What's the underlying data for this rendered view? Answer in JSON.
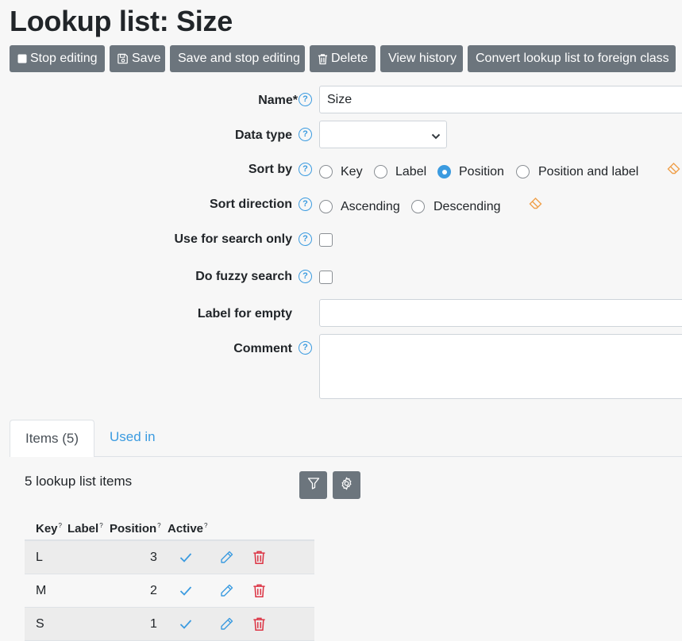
{
  "page": {
    "title": "Lookup list: Size"
  },
  "toolbar": {
    "stop_editing": "Stop editing",
    "save": "Save",
    "save_and_stop": "Save and stop editing",
    "delete": "Delete",
    "view_history": "View history",
    "convert": "Convert lookup list to foreign class"
  },
  "form": {
    "name_label": "Name*",
    "name_value": "Size",
    "data_type_label": "Data type",
    "data_type_value": "",
    "sort_by_label": "Sort by",
    "sort_by_options": [
      "Key",
      "Label",
      "Position",
      "Position and label"
    ],
    "sort_by_selected": "Position",
    "sort_direction_label": "Sort direction",
    "sort_direction_options": [
      "Ascending",
      "Descending"
    ],
    "use_for_search_only_label": "Use for search only",
    "use_for_search_only": false,
    "fuzzy_search_label": "Do fuzzy search",
    "fuzzy_search": false,
    "label_for_empty_label": "Label for empty",
    "label_for_empty_value": "",
    "comment_label": "Comment",
    "comment_value": ""
  },
  "tabs": [
    {
      "label": "Items (5)",
      "active": true
    },
    {
      "label": "Used in",
      "active": false
    }
  ],
  "items_panel": {
    "count_title": "5 lookup list items",
    "columns": [
      "Key",
      "Label",
      "Position",
      "Active"
    ],
    "column_hint": "?",
    "rows": [
      {
        "key": "L",
        "label": "",
        "position": "3",
        "active": true
      },
      {
        "key": "M",
        "label": "",
        "position": "2",
        "active": true
      },
      {
        "key": "S",
        "label": "",
        "position": "1",
        "active": true
      }
    ]
  },
  "colors": {
    "button": "#6c757d",
    "accent": "#3b9be0",
    "eraser": "#f0a04b",
    "delete": "#dc3545"
  },
  "icons": [
    "square-icon",
    "floppy-disk-icon",
    "trash-icon",
    "chevron-down-icon",
    "help-icon",
    "eraser-icon",
    "filter-icon",
    "gear-icon",
    "check-icon",
    "pencil-icon"
  ]
}
